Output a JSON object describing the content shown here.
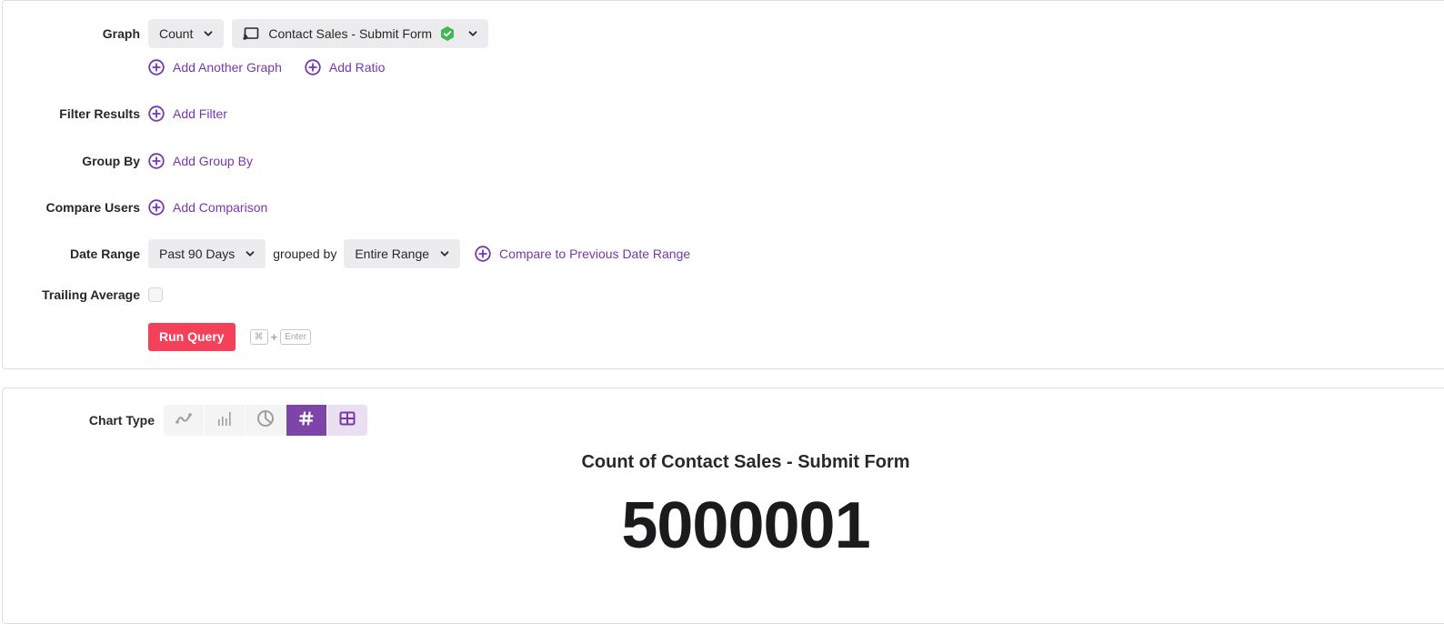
{
  "query": {
    "graph": {
      "label": "Graph",
      "aggregation": "Count",
      "event": "Contact Sales - Submit Form",
      "event_icon": "screen-cast-icon",
      "verified_icon": "verified-shield-icon",
      "add_another_graph": "Add Another Graph",
      "add_ratio": "Add Ratio"
    },
    "filter": {
      "label": "Filter Results",
      "add": "Add Filter"
    },
    "group_by": {
      "label": "Group By",
      "add": "Add Group By"
    },
    "compare_users": {
      "label": "Compare Users",
      "add": "Add Comparison"
    },
    "date_range": {
      "label": "Date Range",
      "value": "Past 90 Days",
      "grouped_by_text": "grouped by",
      "grouping": "Entire Range",
      "compare": "Compare to Previous Date Range"
    },
    "trailing_average": {
      "label": "Trailing Average",
      "checked": false
    },
    "run": {
      "label": "Run Query",
      "shortcut_key1": "⌘",
      "shortcut_plus": "+",
      "shortcut_key2": "Enter"
    }
  },
  "result": {
    "chart_type_label": "Chart Type",
    "chart_types": [
      {
        "name": "line",
        "icon": "line-chart-icon",
        "selected": false
      },
      {
        "name": "bar",
        "icon": "bar-chart-icon",
        "selected": false
      },
      {
        "name": "pie",
        "icon": "pie-chart-icon",
        "selected": false
      },
      {
        "name": "number",
        "icon": "hash-icon",
        "selected": true
      },
      {
        "name": "table",
        "icon": "table-icon",
        "selected": false
      }
    ],
    "title": "Count of Contact Sales - Submit Form",
    "value": "5000001"
  },
  "colors": {
    "accent": "#7637b0",
    "selected_chart_type": "#7d45a7",
    "run_button": "#f5405a",
    "verified": "#3fb950"
  }
}
